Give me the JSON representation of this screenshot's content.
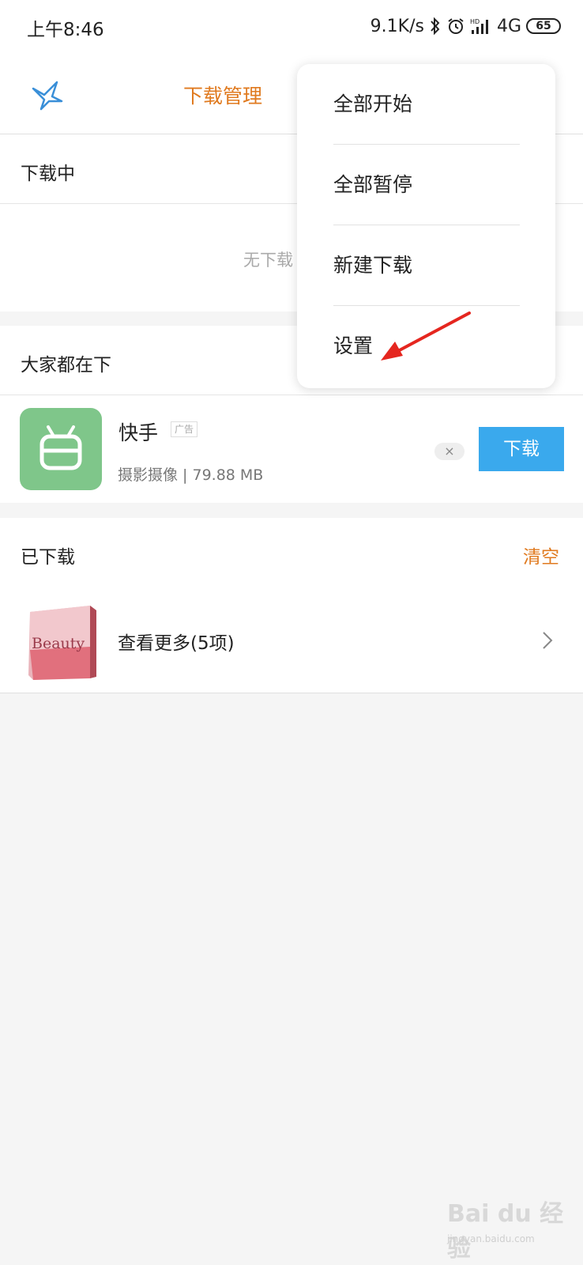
{
  "status_bar": {
    "time": "上午8:46",
    "speed": "9.1K/s",
    "network": "4G",
    "battery": "65"
  },
  "app_bar": {
    "title": "下载管理"
  },
  "downloading": {
    "header": "下载中",
    "empty_text": "无下载"
  },
  "recommend": {
    "header": "大家都在下",
    "app": {
      "name": "快手",
      "tag": "广告",
      "meta": "摄影摄像 | 79.88 MB",
      "close_icon": "×",
      "download_label": "下载",
      "icon_color": "#7fc68a"
    }
  },
  "downloaded": {
    "header": "已下载",
    "clear_label": "清空",
    "more_label": "查看更多(5项)",
    "thumb_text": "Beauty"
  },
  "menu": {
    "items": [
      "全部开始",
      "全部暂停",
      "新建下载",
      "设置"
    ]
  },
  "watermark": {
    "main": "Bai du 经验",
    "sub": "jingyan.baidu.com"
  },
  "colors": {
    "accent_orange": "#e07a1f",
    "button_blue": "#3aa9ed",
    "annotation_red": "#e5261f"
  }
}
